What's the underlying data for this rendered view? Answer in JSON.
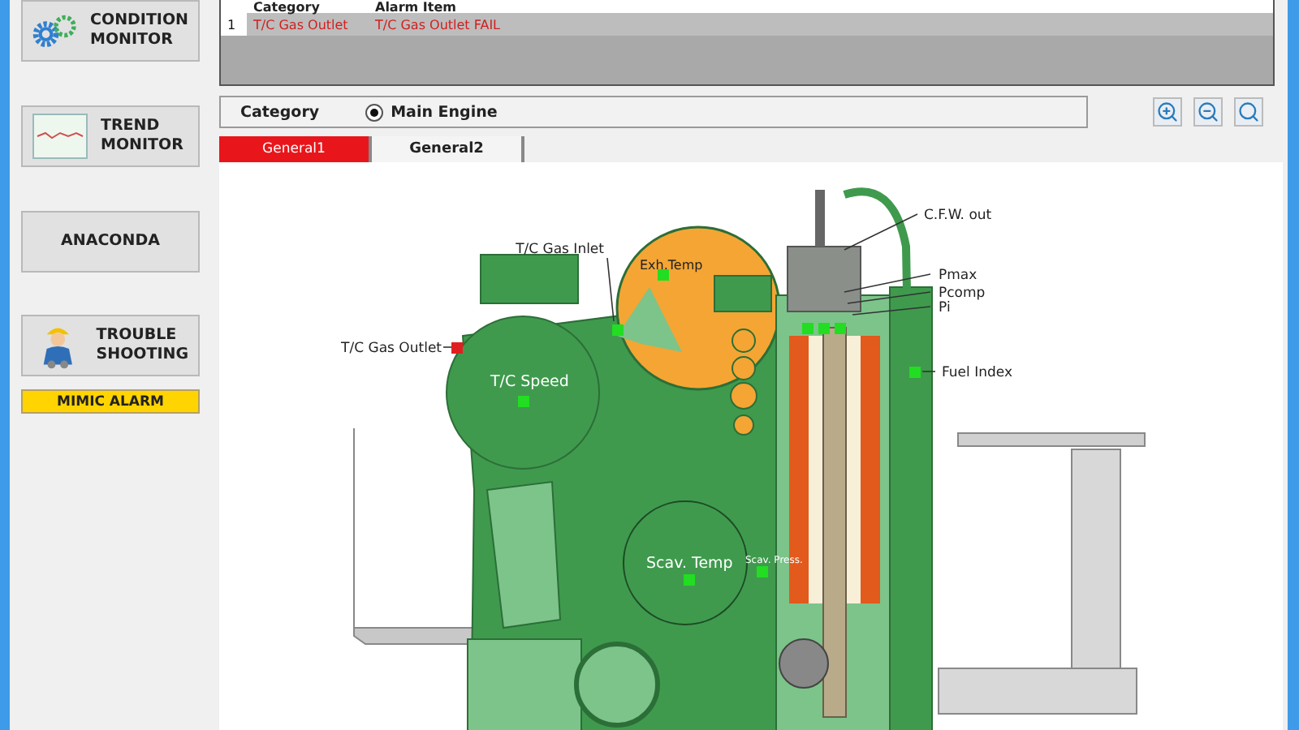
{
  "sidebar": {
    "buttons": [
      {
        "kind": "gears",
        "lines": [
          "CONDITION",
          "MONITOR"
        ]
      },
      {
        "kind": "trend",
        "lines": [
          "TREND",
          "MONITOR"
        ]
      },
      {
        "kind": "plain",
        "lines": [
          "ANACONDA"
        ]
      },
      {
        "kind": "worker",
        "lines": [
          "TROUBLE",
          "SHOOTING"
        ]
      }
    ],
    "alarm_badge": "MIMIC ALARM"
  },
  "alarm_table": {
    "columns": [
      "Category",
      "Alarm Item"
    ],
    "rows": [
      {
        "number": "1",
        "category": "T/C Gas Outlet",
        "item": "T/C Gas Outlet FAIL"
      }
    ]
  },
  "category": {
    "label": "Category",
    "options": [
      {
        "label": "Main Engine",
        "selected": true
      }
    ]
  },
  "tabs": [
    {
      "label": "General1",
      "selected": true
    },
    {
      "label": "General2",
      "selected": false
    }
  ],
  "diagram": {
    "labels": [
      {
        "text": "T/C Gas Inlet"
      },
      {
        "text": "Exh.Temp"
      },
      {
        "text": "C.F.W. out"
      },
      {
        "text": "Pmax"
      },
      {
        "text": "Pcomp"
      },
      {
        "text": "Pi"
      },
      {
        "text": "T/C Gas Outlet"
      },
      {
        "text": "T/C Speed"
      },
      {
        "text": "Fuel Index"
      },
      {
        "text": "Scav. Temp"
      },
      {
        "text": "Scav. Press."
      }
    ],
    "markers": [
      {
        "color": "#22dd22"
      },
      {
        "color": "#22dd22"
      },
      {
        "color": "#e02020"
      },
      {
        "color": "#22dd22"
      },
      {
        "color": "#22dd22"
      },
      {
        "color": "#22dd22"
      },
      {
        "color": "#22dd22"
      },
      {
        "color": "#22dd22"
      },
      {
        "color": "#22dd22"
      },
      {
        "color": "#22dd22"
      }
    ]
  }
}
